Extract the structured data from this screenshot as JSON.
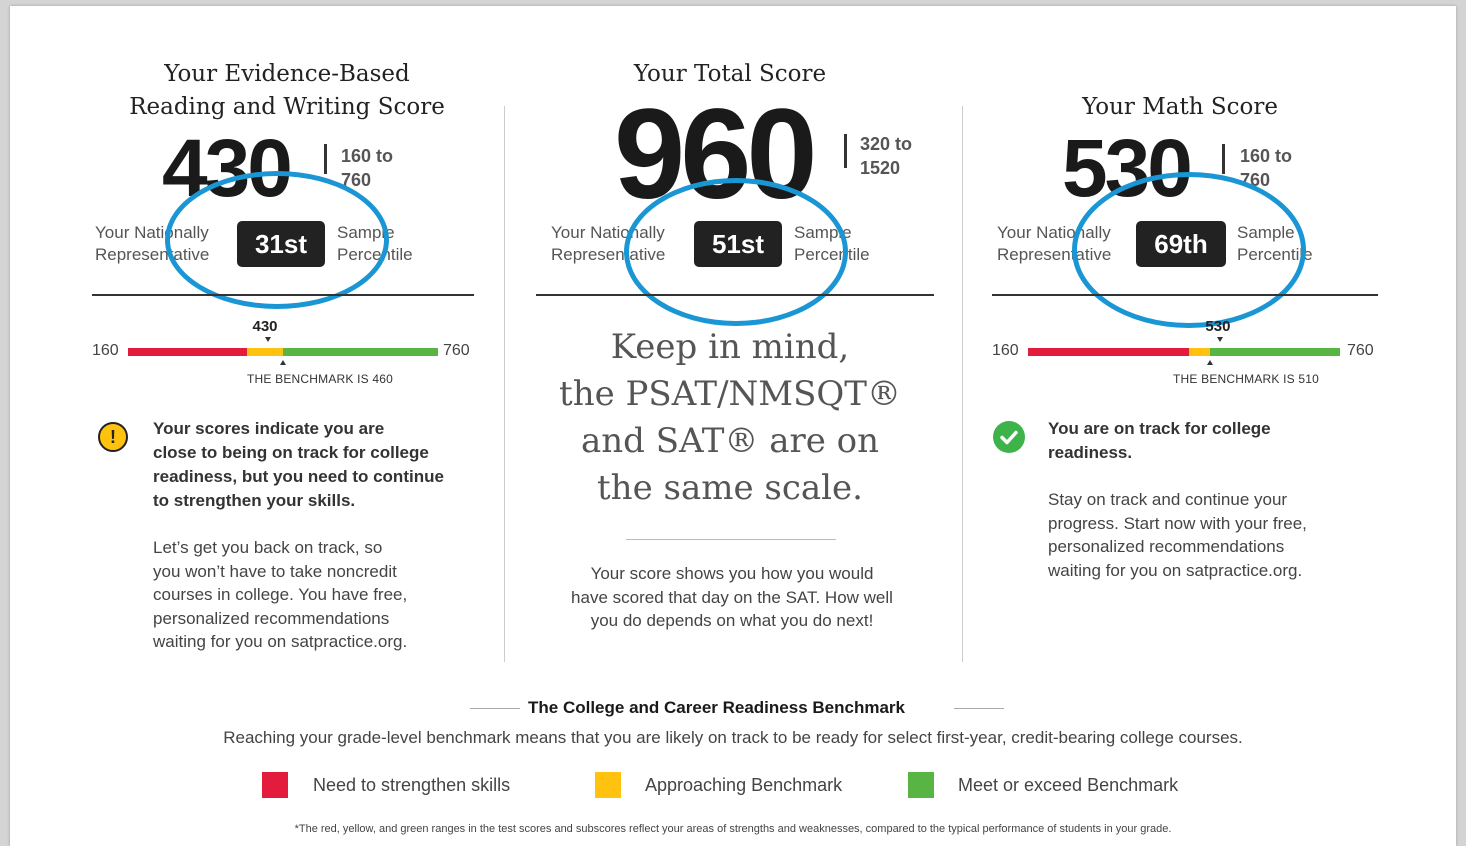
{
  "colors": {
    "red": "#e31c3d",
    "yellow": "#ffc20e",
    "green": "#58b443",
    "circle": "#1a96d4"
  },
  "reading": {
    "title_line1": "Your Evidence-Based",
    "title_line2": "Reading and Writing Score",
    "score": "430",
    "range_line1": "160 to",
    "range_line2": "760",
    "pct_left1": "Your Nationally",
    "pct_left2": "Representative",
    "percentile": "31st",
    "pct_right1": "Sample",
    "pct_right2": "Percentile",
    "axis_min": "160",
    "axis_max": "760",
    "marker_value": "430",
    "benchmark_text": "THE BENCHMARK IS 460",
    "bar": {
      "min": 160,
      "max": 760,
      "score": 430,
      "benchmark": 460,
      "yellow_start": 390
    },
    "message_bold": [
      "Your scores indicate you are",
      "close to being on track for college",
      "readiness, but you need to continue",
      "to strengthen your skills."
    ],
    "message": [
      "Let’s get you back on track, so",
      "you won’t have to take noncredit",
      "courses in college. You have free,",
      "personalized recommendations",
      "waiting for you on satpractice.org."
    ],
    "icon": "!"
  },
  "total": {
    "title": "Your Total Score",
    "score": "960",
    "range_line1": "320 to",
    "range_line2": "1520",
    "pct_left1": "Your Nationally",
    "pct_left2": "Representative",
    "percentile": "51st",
    "pct_right1": "Sample",
    "pct_right2": "Percentile",
    "keep_lines": [
      "Keep in mind,",
      "the PSAT/NMSQT®",
      "and SAT® are on",
      "the same scale."
    ],
    "message": [
      "Your score shows you how you would",
      "have scored that day on the SAT. How well",
      "you do depends on what you do next!"
    ]
  },
  "math": {
    "title": "Your Math Score",
    "score": "530",
    "range_line1": "160 to",
    "range_line2": "760",
    "pct_left1": "Your Nationally",
    "pct_left2": "Representative",
    "percentile": "69th",
    "pct_right1": "Sample",
    "pct_right2": "Percentile",
    "axis_min": "160",
    "axis_max": "760",
    "marker_value": "530",
    "benchmark_text": "THE BENCHMARK IS 510",
    "bar": {
      "min": 160,
      "max": 760,
      "score": 530,
      "benchmark": 510,
      "yellow_start": 470
    },
    "message_bold": [
      "You are on track for college",
      "readiness."
    ],
    "message": [
      "Stay on track and continue your",
      "progress. Start now with your free,",
      "personalized recommendations",
      "waiting for you on satpractice.org."
    ]
  },
  "footer": {
    "title": "The College and Career Readiness Benchmark",
    "text": "Reaching your grade-level benchmark means that you are likely on track to be ready for select first-year, credit-bearing college courses.",
    "legend": [
      {
        "label": "Need to strengthen skills",
        "color": "#e31c3d"
      },
      {
        "label": "Approaching Benchmark",
        "color": "#ffc20e"
      },
      {
        "label": "Meet or exceed Benchmark",
        "color": "#58b443"
      }
    ],
    "note": "*The red, yellow, and green ranges in the test scores and subscores reflect your areas of strengths and weaknesses, compared to the typical performance of students in your grade."
  }
}
